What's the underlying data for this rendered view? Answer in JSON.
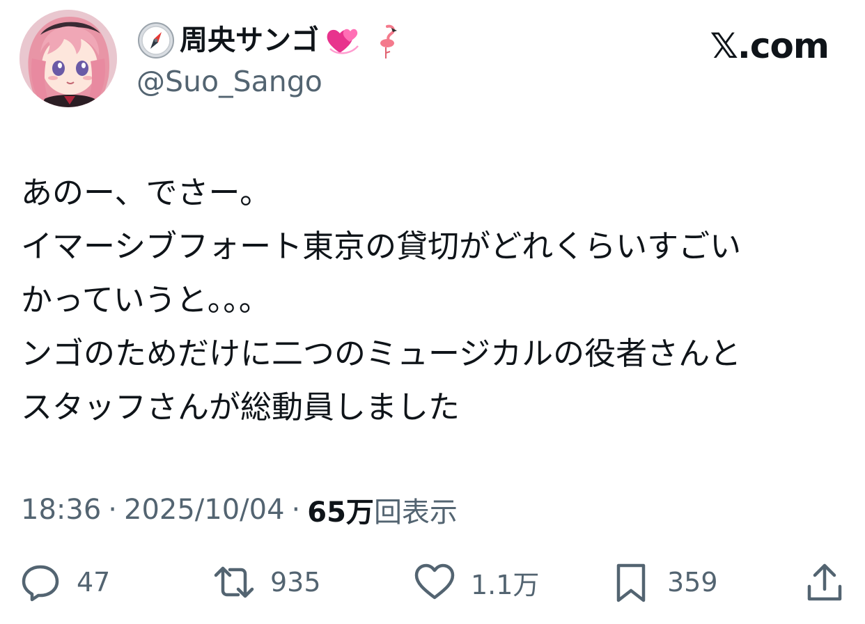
{
  "header": {
    "display_name": "周央サンゴ",
    "handle": "@Suo_Sango",
    "brand": "𝕏.com",
    "name_icons": [
      "compass-icon",
      "hearts-icon",
      "flamingo-icon"
    ]
  },
  "tweet": {
    "lines": [
      "あのー、でさー。",
      "イマーシブフォート東京の貸切がどれくらいすごい",
      "かっていうと。。。",
      "ンゴのためだけに二つのミュージカルの役者さんと",
      "スタッフさんが総動員しました"
    ]
  },
  "meta": {
    "time": "18:36",
    "separator": "·",
    "date": "2025/10/04",
    "views_count": "65万",
    "views_label": "回表示"
  },
  "actions": {
    "replies": "47",
    "reposts": "935",
    "likes": "1.1万",
    "bookmarks": "359"
  },
  "colors": {
    "text": "#0f1419",
    "muted": "#536471",
    "background": "#ffffff"
  }
}
